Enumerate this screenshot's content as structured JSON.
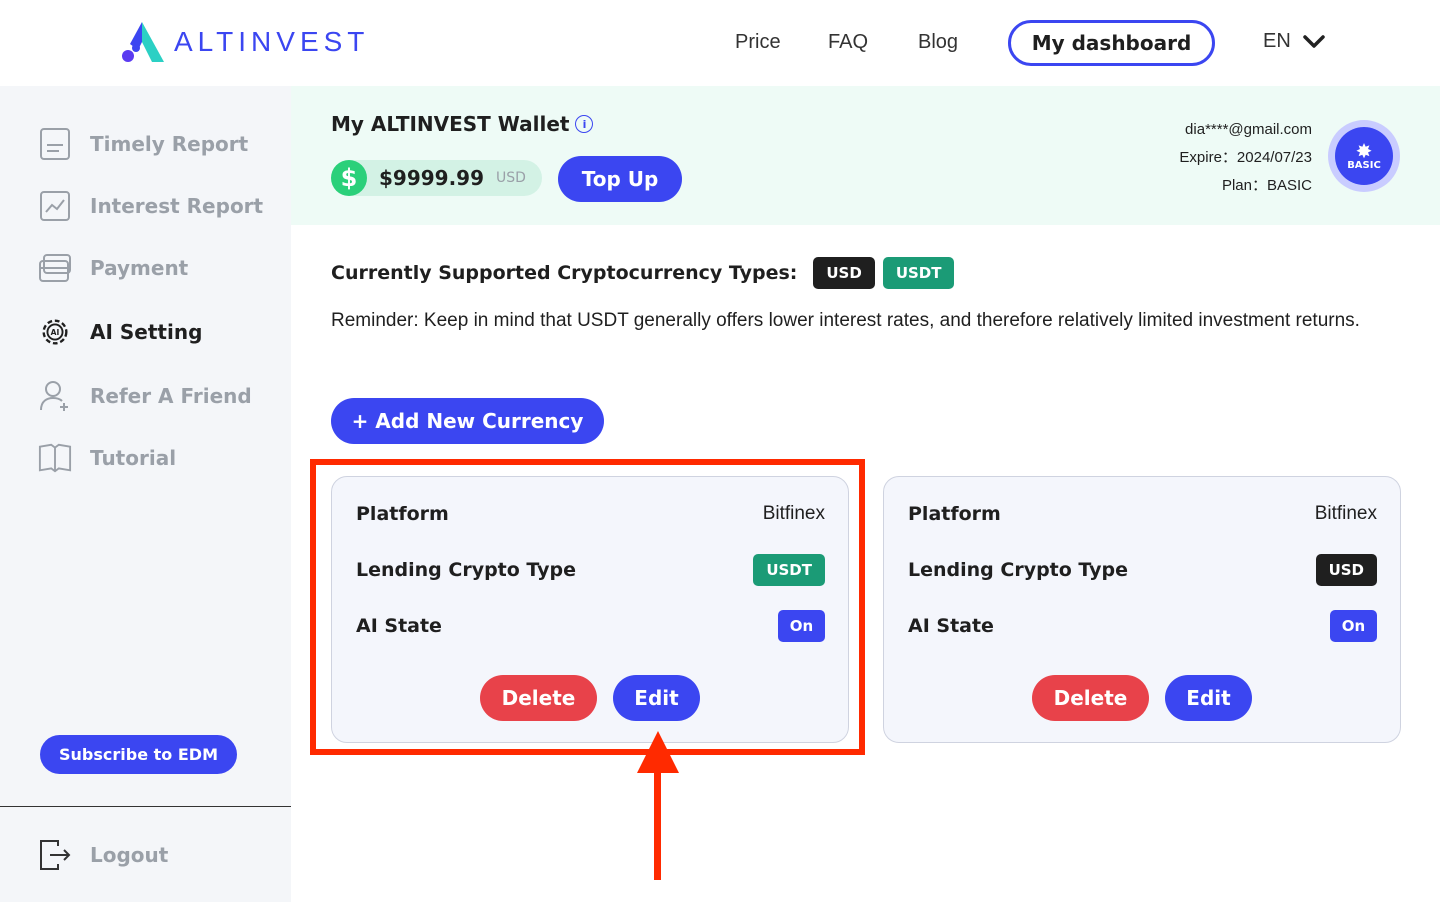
{
  "brand": {
    "name": "ALTINVEST",
    "primary_color": "#3b46f1"
  },
  "nav": {
    "links": [
      "Price",
      "FAQ",
      "Blog"
    ],
    "dashboard_label": "My dashboard",
    "language": "EN"
  },
  "sidebar": {
    "items": [
      {
        "label": "Timely Report",
        "icon": "document-icon",
        "active": false
      },
      {
        "label": "Interest Report",
        "icon": "chart-icon",
        "active": false
      },
      {
        "label": "Payment",
        "icon": "card-icon",
        "active": false
      },
      {
        "label": "AI Setting",
        "icon": "ai-gear-icon",
        "active": true
      },
      {
        "label": "Refer A Friend",
        "icon": "user-add-icon",
        "active": false
      },
      {
        "label": "Tutorial",
        "icon": "book-icon",
        "active": false
      }
    ],
    "subscribe_label": "Subscribe to EDM",
    "logout_label": "Logout"
  },
  "wallet": {
    "title": "My ALTINVEST Wallet",
    "info_icon_text": "i",
    "currency_symbol": "$",
    "balance": "$9999.99",
    "unit": "USD",
    "topup_label": "Top Up",
    "email": "dia****@gmail.com",
    "expire": "Expire：2024/07/23",
    "plan": "Plan：BASIC",
    "badge_text": "BASIC"
  },
  "main": {
    "supported_label": "Currently Supported Cryptocurrency Types:",
    "supported_tags": [
      "USD",
      "USDT"
    ],
    "reminder": "Reminder: Keep in mind that USDT generally offers lower interest rates, and  therefore relatively limited investment returns.",
    "add_label": "+ Add New Currency"
  },
  "cards": [
    {
      "platform_label": "Platform",
      "platform_value": "Bitfinex",
      "type_label": "Lending Crypto Type",
      "type_value": "USDT",
      "state_label": "AI State",
      "state_value": "On",
      "delete_label": "Delete",
      "edit_label": "Edit"
    },
    {
      "platform_label": "Platform",
      "platform_value": "Bitfinex",
      "type_label": "Lending Crypto Type",
      "type_value": "USD",
      "state_label": "AI State",
      "state_value": "On",
      "delete_label": "Delete",
      "edit_label": "Edit"
    }
  ],
  "colors": {
    "annotation": "#ff2a00",
    "delete": "#e8424a",
    "usdt_tag": "#1b9b76",
    "usd_tag": "#1f1f1f"
  }
}
